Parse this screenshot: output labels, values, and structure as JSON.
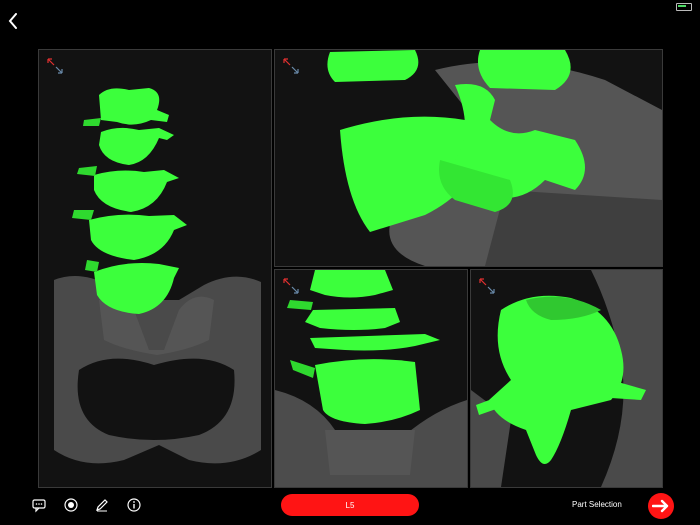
{
  "topbar": {
    "back_icon": "chevron-left-icon"
  },
  "viewports": [
    {
      "name": "main",
      "expand_icon": "expand-arrows-icon"
    },
    {
      "name": "top",
      "expand_icon": "expand-arrows-icon"
    },
    {
      "name": "bottom-left",
      "expand_icon": "expand-arrows-icon"
    },
    {
      "name": "bottom-right",
      "expand_icon": "expand-arrows-icon"
    }
  ],
  "toolbar": {
    "tools": [
      "comment-icon",
      "record-icon",
      "pencil-icon",
      "info-icon"
    ],
    "selected_part": "L5",
    "part_selection_label": "Part Selection",
    "next_icon": "arrow-right-icon"
  },
  "colors": {
    "accent": "#ff1414",
    "bone_green": "#3cff3c",
    "bone_gray": "#5a5a5a",
    "background": "#000000"
  }
}
